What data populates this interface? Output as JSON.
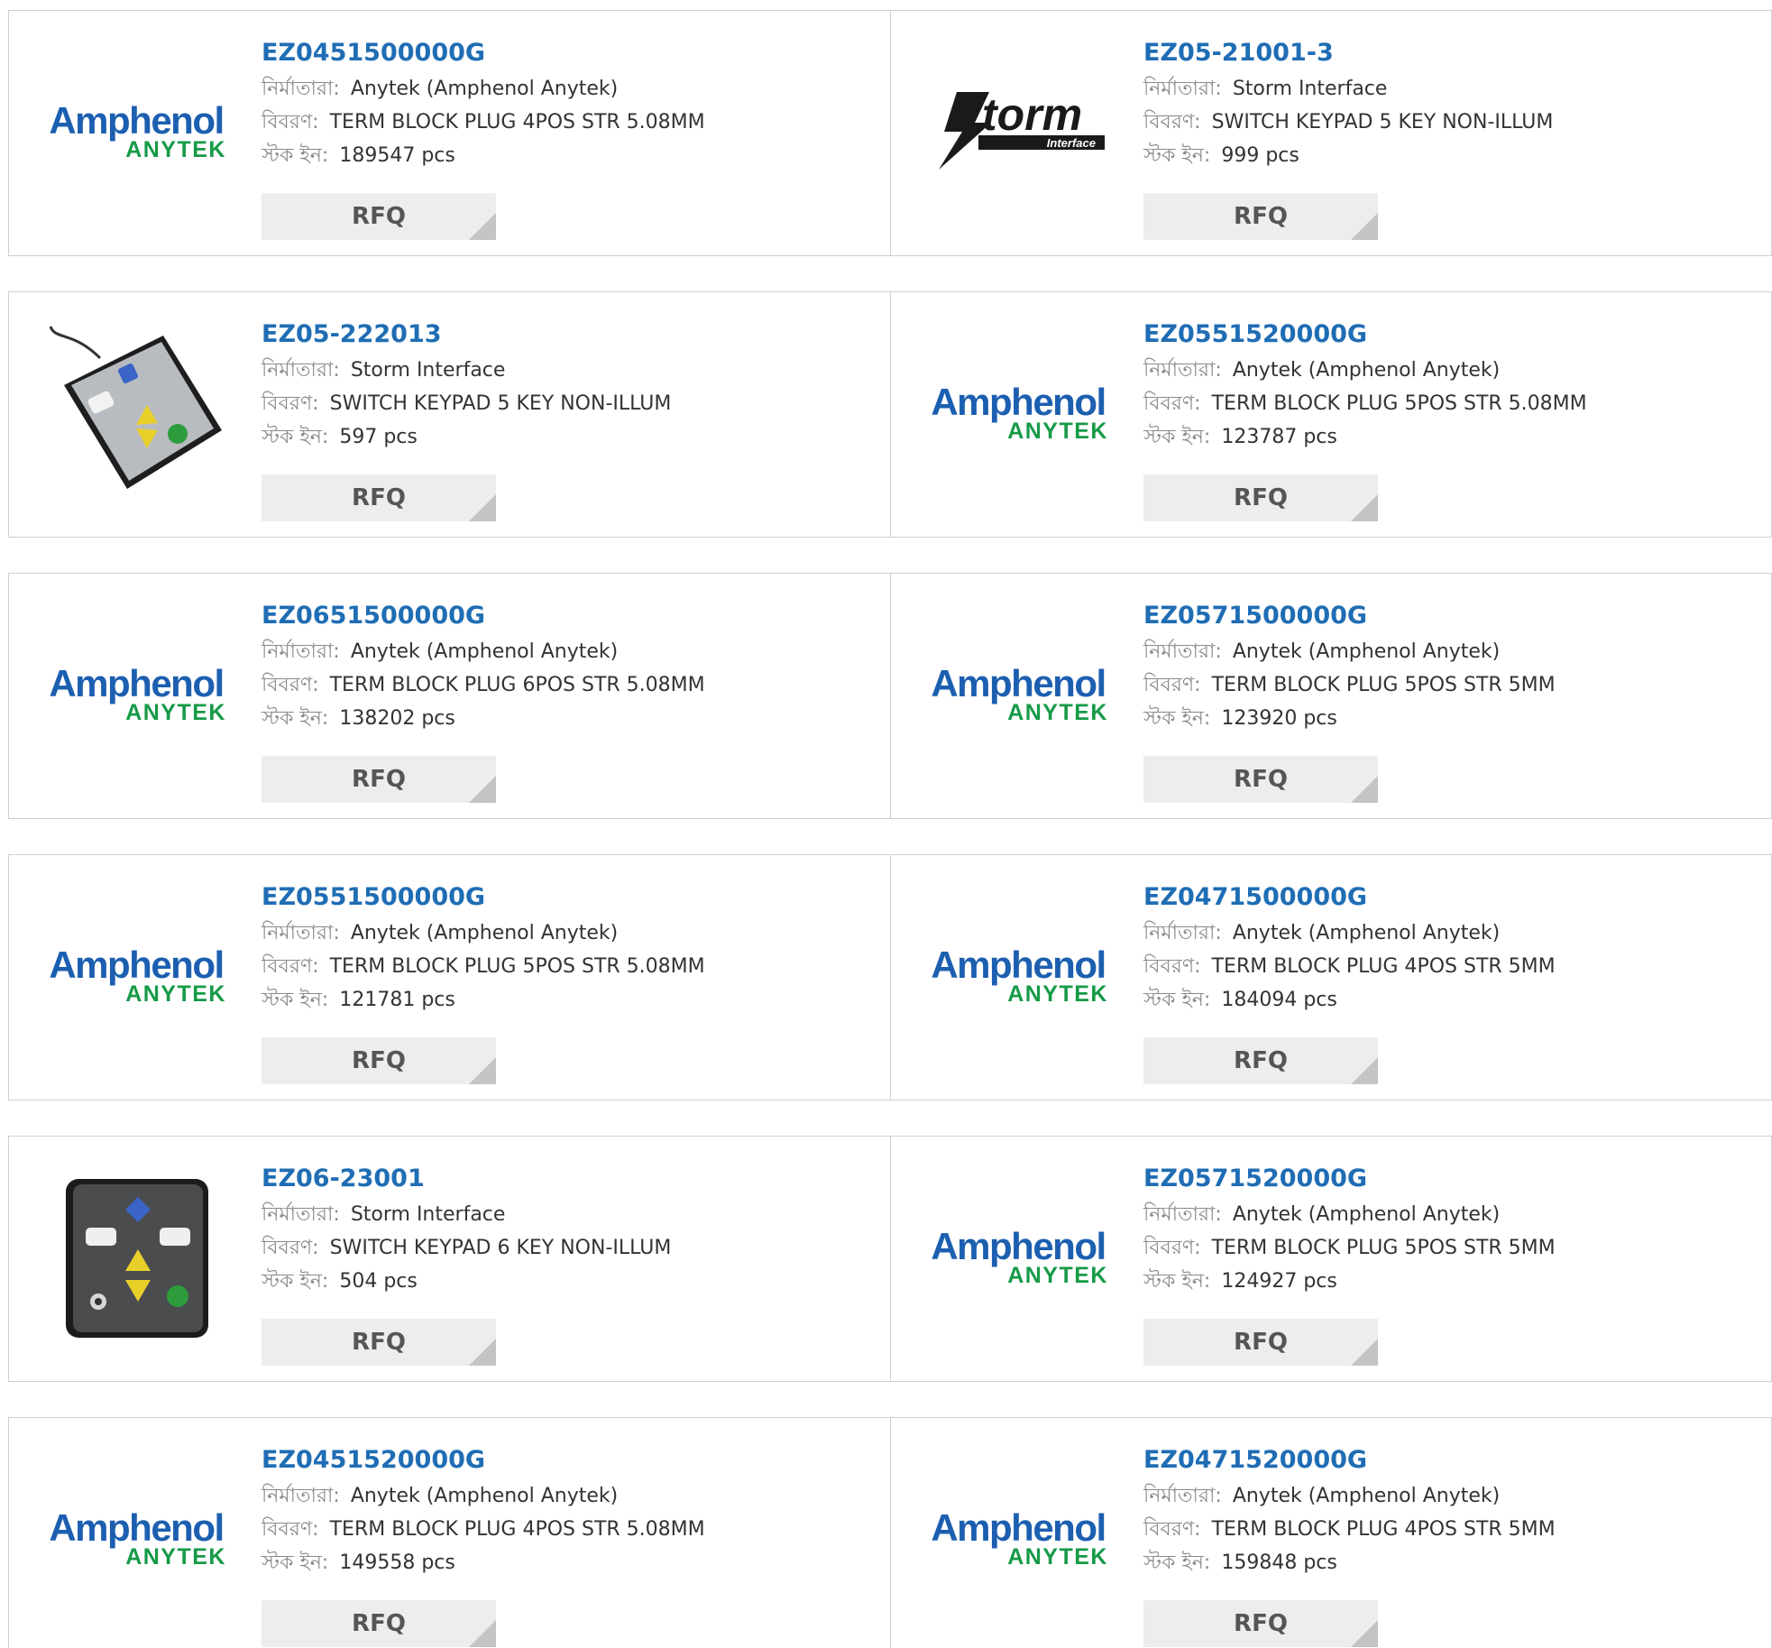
{
  "labels": {
    "manufacturer": "নির্মাতারা:",
    "description": "বিবরণ:",
    "stock": "স্টক ইন:"
  },
  "rfq_label": "RFQ",
  "logos": {
    "amphenol_top": "Amphenol",
    "amphenol_bottom": "ANYTEK",
    "storm_main": "torm",
    "storm_sub": "Interface"
  },
  "colors": {
    "part_link": "#1f6db4",
    "amphenol_blue": "#1c5fb0",
    "anytek_green": "#169a47",
    "rfq_bg": "#ededed",
    "border": "#cfcfcf"
  },
  "products": [
    [
      {
        "part": "EZ0451500000G",
        "manufacturer": "Anytek (Amphenol Anytek)",
        "description": "TERM BLOCK PLUG 4POS STR 5.08MM",
        "stock": "189547 pcs",
        "image": "amphenol-anytek-logo"
      },
      {
        "part": "EZ05-21001-3",
        "manufacturer": "Storm Interface",
        "description": "SWITCH KEYPAD 5 KEY NON-ILLUM",
        "stock": "999 pcs",
        "image": "storm-interface-logo"
      }
    ],
    [
      {
        "part": "EZ05-222013",
        "manufacturer": "Storm Interface",
        "description": "SWITCH KEYPAD 5 KEY NON-ILLUM",
        "stock": "597 pcs",
        "image": "keypad-5key-photo"
      },
      {
        "part": "EZ0551520000G",
        "manufacturer": "Anytek (Amphenol Anytek)",
        "description": "TERM BLOCK PLUG 5POS STR 5.08MM",
        "stock": "123787 pcs",
        "image": "amphenol-anytek-logo"
      }
    ],
    [
      {
        "part": "EZ0651500000G",
        "manufacturer": "Anytek (Amphenol Anytek)",
        "description": "TERM BLOCK PLUG 6POS STR 5.08MM",
        "stock": "138202 pcs",
        "image": "amphenol-anytek-logo"
      },
      {
        "part": "EZ0571500000G",
        "manufacturer": "Anytek (Amphenol Anytek)",
        "description": "TERM BLOCK PLUG 5POS STR 5MM",
        "stock": "123920 pcs",
        "image": "amphenol-anytek-logo"
      }
    ],
    [
      {
        "part": "EZ0551500000G",
        "manufacturer": "Anytek (Amphenol Anytek)",
        "description": "TERM BLOCK PLUG 5POS STR 5.08MM",
        "stock": "121781 pcs",
        "image": "amphenol-anytek-logo"
      },
      {
        "part": "EZ0471500000G",
        "manufacturer": "Anytek (Amphenol Anytek)",
        "description": "TERM BLOCK PLUG 4POS STR 5MM",
        "stock": "184094 pcs",
        "image": "amphenol-anytek-logo"
      }
    ],
    [
      {
        "part": "EZ06-23001",
        "manufacturer": "Storm Interface",
        "description": "SWITCH KEYPAD 6 KEY NON-ILLUM",
        "stock": "504 pcs",
        "image": "keypad-6key-photo"
      },
      {
        "part": "EZ0571520000G",
        "manufacturer": "Anytek (Amphenol Anytek)",
        "description": "TERM BLOCK PLUG 5POS STR 5MM",
        "stock": "124927 pcs",
        "image": "amphenol-anytek-logo"
      }
    ],
    [
      {
        "part": "EZ0451520000G",
        "manufacturer": "Anytek (Amphenol Anytek)",
        "description": "TERM BLOCK PLUG 4POS STR 5.08MM",
        "stock": "149558 pcs",
        "image": "amphenol-anytek-logo"
      },
      {
        "part": "EZ0471520000G",
        "manufacturer": "Anytek (Amphenol Anytek)",
        "description": "TERM BLOCK PLUG 4POS STR 5MM",
        "stock": "159848 pcs",
        "image": "amphenol-anytek-logo"
      }
    ]
  ]
}
